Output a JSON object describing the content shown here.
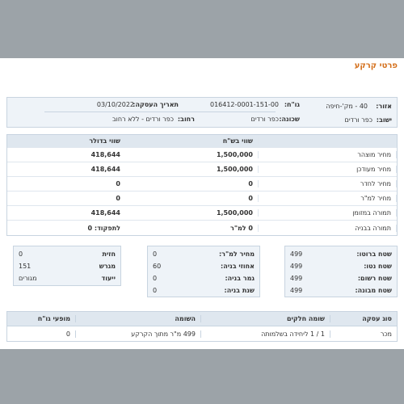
{
  "title": "פרטי קרקע",
  "header_panel": {
    "area_label": "אזור:",
    "area_value": "40 - מק'-חיפה",
    "gush_label": "גו\"ח:",
    "gush_value": "016412-0001-151-00",
    "deal_date_label": "תאריך העסקה:",
    "deal_date_value": "03/10/2022",
    "settlement_label": "ישוב:",
    "settlement_value": "כפר ורדים",
    "neighborhood_label": "שכונה:",
    "neighborhood_value": "כפר ורדים",
    "street_label": "רחוב:",
    "street_value": "כפר ורדים - ללא רחוב"
  },
  "price_table": {
    "headers": [
      "",
      "שווי בש\"ח",
      "שווי בדולר"
    ],
    "rows": [
      {
        "label": "מחיר מוצהר",
        "ils": "1,500,000",
        "usd": "418,644"
      },
      {
        "label": "מחיר מעודכן",
        "ils": "1,500,000",
        "usd": "418,644"
      },
      {
        "label": "מחיר לחדר",
        "ils": "0",
        "usd": "0"
      },
      {
        "label": "מחיר למ\"ר",
        "ils": "0",
        "usd": "0"
      },
      {
        "label": "תמורה במזומן",
        "ils": "1,500,000",
        "usd": "418,644"
      },
      {
        "label": "תמורה בבניה",
        "ils": "0 למ\"ר",
        "usd": "לתפקוד: 0"
      }
    ]
  },
  "box_right": {
    "rows": [
      {
        "label": "שטח ברוטו:",
        "value": "499"
      },
      {
        "label": "שטח נטו:",
        "value": "499"
      },
      {
        "label": "שטח רשום:",
        "value": "499"
      },
      {
        "label": "שטח מבונה:",
        "value": "499"
      }
    ]
  },
  "box_middle": {
    "rows": [
      {
        "label": "מחיר למ\"ר:",
        "value": "0"
      },
      {
        "label": "אחוזי בניה:",
        "value": "60"
      },
      {
        "label": "גמר בניה:",
        "value": "0"
      },
      {
        "label": "שנת בניה:",
        "value": "0"
      }
    ]
  },
  "box_left": {
    "rows": [
      {
        "label": "חזית",
        "value": "0"
      },
      {
        "label": "מגרש",
        "value": "151"
      },
      {
        "label": "ייעוד",
        "value": "מגורים"
      }
    ]
  },
  "bottom_table": {
    "headers": [
      "סוג עסקה",
      "שומה חלקים",
      "השומה",
      "מופעי גו\"ח"
    ],
    "row": [
      "מכר",
      "1 / 1 ליחידה בשלמותה",
      "499 מ\"ר מתוך הקרקע",
      "0"
    ]
  }
}
